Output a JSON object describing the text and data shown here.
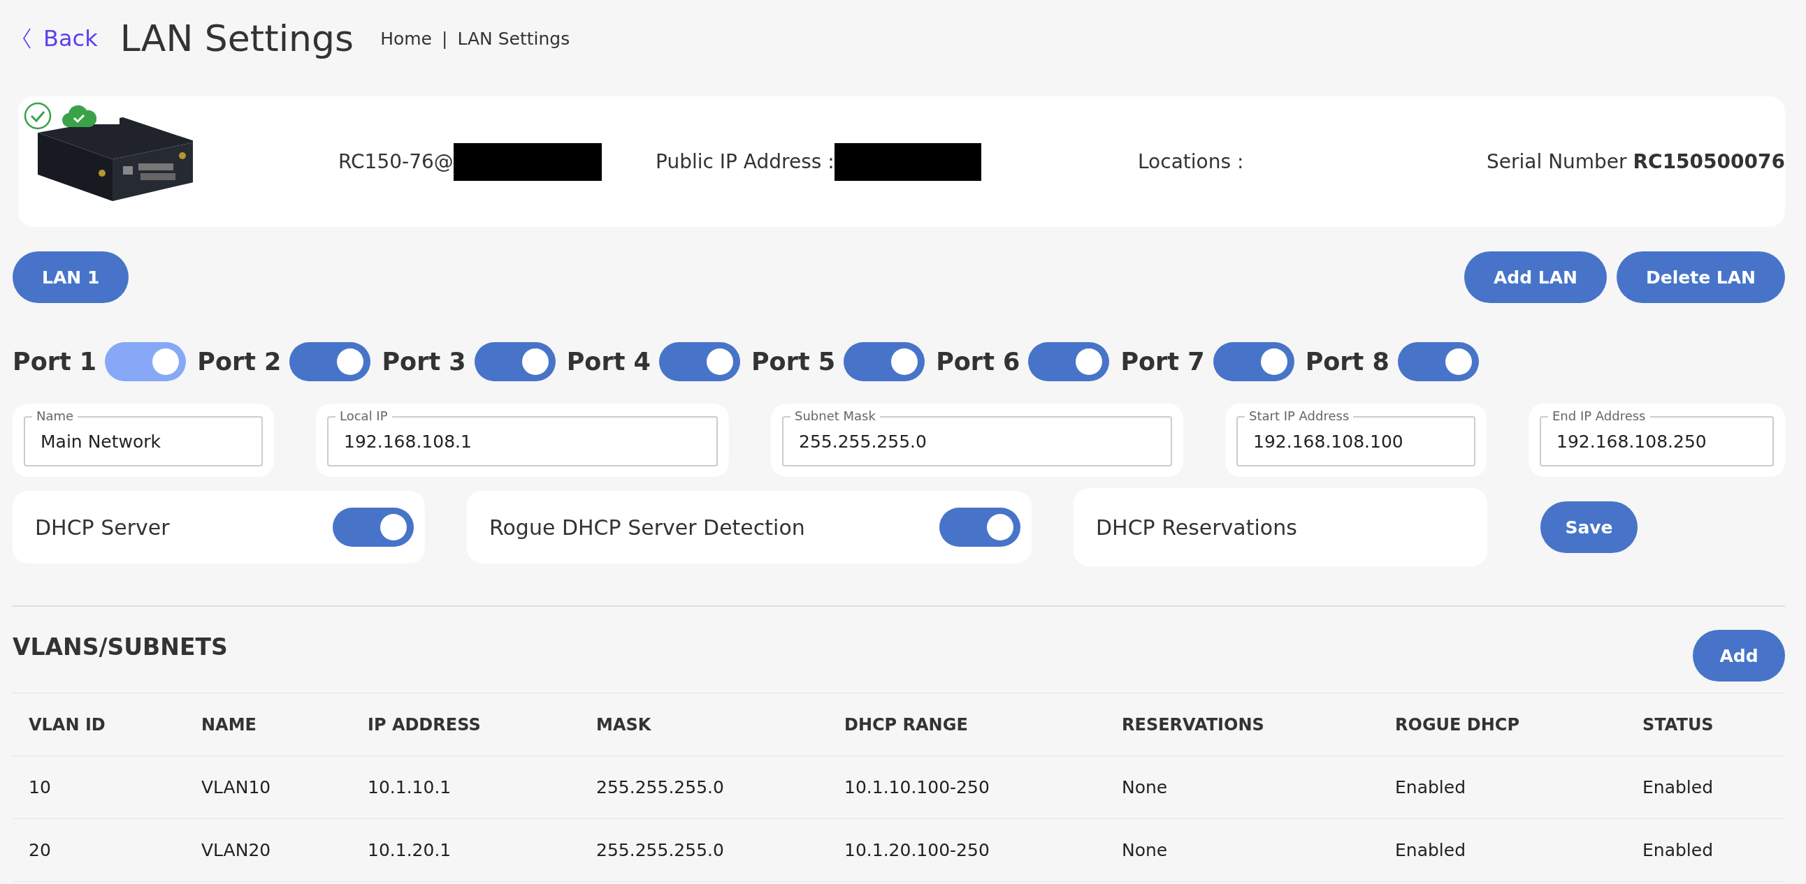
{
  "header": {
    "back": "Back",
    "title": "LAN Settings",
    "breadcrumb": [
      "Home",
      "LAN Settings"
    ],
    "breadcrumb_separator": "|"
  },
  "device": {
    "name": "RC150-76@",
    "public_ip_label": "Public IP Address :",
    "locations_label": "Locations :",
    "serial_label": "Serial Number",
    "serial": "RC150500076",
    "online": true,
    "cloud_connected": true
  },
  "lan_tabs": [
    {
      "label": "LAN 1",
      "selected": true
    }
  ],
  "actions": [
    "Add LAN",
    "Delete LAN"
  ],
  "ports": [
    {
      "label": "Port 1",
      "on": true,
      "disabled": true
    },
    {
      "label": "Port 2",
      "on": true,
      "disabled": false
    },
    {
      "label": "Port 3",
      "on": true,
      "disabled": false
    },
    {
      "label": "Port 4",
      "on": true,
      "disabled": false
    },
    {
      "label": "Port 5",
      "on": true,
      "disabled": false
    },
    {
      "label": "Port 6",
      "on": true,
      "disabled": false
    },
    {
      "label": "Port 7",
      "on": true,
      "disabled": false
    },
    {
      "label": "Port 8",
      "on": true,
      "disabled": false
    }
  ],
  "fields": [
    {
      "label": "Name",
      "value": "Main Network"
    },
    {
      "label": "Local IP",
      "value": "192.168.108.1"
    },
    {
      "label": "Subnet Mask",
      "value": "255.255.255.0"
    },
    {
      "label": "Start IP Address",
      "value": "192.168.108.100"
    },
    {
      "label": "End IP Address",
      "value": "192.168.108.250"
    }
  ],
  "settings": [
    {
      "kind": "switch",
      "label": "DHCP Server",
      "on": true
    },
    {
      "kind": "switch",
      "label": "Rogue DHCP Server Detection",
      "on": true
    },
    {
      "kind": "link",
      "label": "DHCP Reservations"
    }
  ],
  "save": "Save",
  "vlans": {
    "title": "VLANS/SUBNETS",
    "add": "Add",
    "columns": [
      "VLAN ID",
      "NAME",
      "IP ADDRESS",
      "MASK",
      "DHCP RANGE",
      "RESERVATIONS",
      "ROGUE DHCP",
      "STATUS"
    ],
    "rows": [
      [
        "10",
        "VLAN10",
        "10.1.10.1",
        "255.255.255.0",
        "10.1.10.100-250",
        "None",
        "Enabled",
        "Enabled"
      ],
      [
        "20",
        "VLAN20",
        "10.1.20.1",
        "255.255.255.0",
        "10.1.20.100-250",
        "None",
        "Enabled",
        "Enabled"
      ]
    ]
  }
}
